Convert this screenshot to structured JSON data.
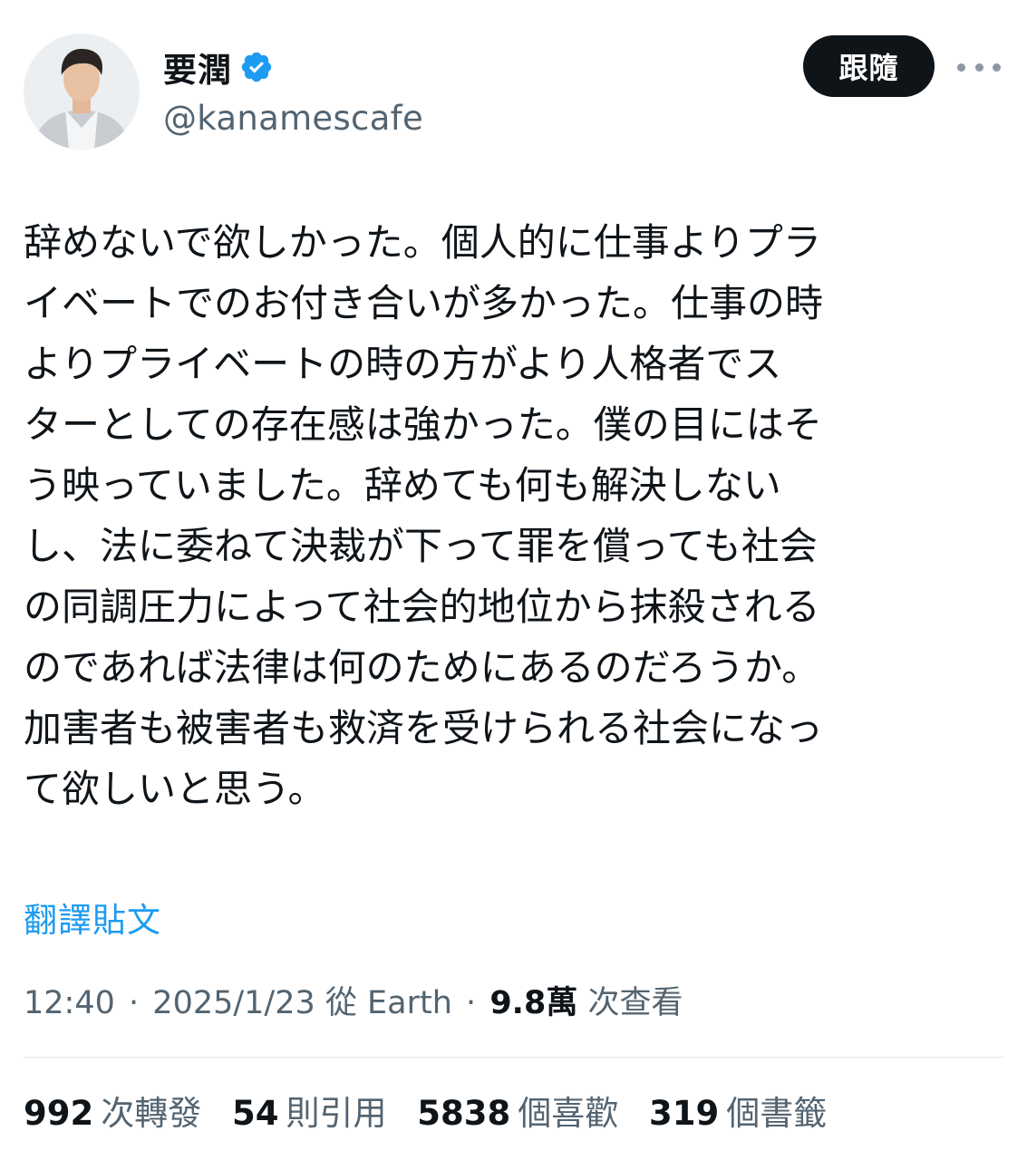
{
  "author": {
    "display_name": "要潤",
    "handle": "@kanamescafe",
    "verified": true
  },
  "header": {
    "follow_label": "跟隨"
  },
  "tweet": {
    "text": "辞めないで欲しかった。個人的に仕事よりプラ\nイベートでのお付き合いが多かった。仕事の時\nよりプライベートの時の方がより人格者でス\nターとしての存在感は強かった。僕の目にはそ\nう映っていました。辞めても何も解決しない\nし、法に委ねて決裁が下って罪を償っても社会\nの同調圧力によって社会的地位から抹殺される\nのであれば法律は何のためにあるのだろうか。\n加害者も被害者も救済を受けられる社会になっ\nて欲しいと思う。",
    "translate_label": "翻譯貼文"
  },
  "meta": {
    "time": "12:40",
    "date": "2025/1/23",
    "source": "從 Earth",
    "views_count": "9.8萬",
    "views_label": "次查看"
  },
  "stats": {
    "retweets_count": "992",
    "retweets_label": "次轉發",
    "quotes_count": "54",
    "quotes_label": "則引用",
    "likes_count": "5838",
    "likes_label": "個喜歡",
    "bookmarks_count": "319",
    "bookmarks_label": "個書籤"
  },
  "colors": {
    "verified_badge": "#1d9bf0",
    "link": "#1d9bf0",
    "secondary_text": "#536471",
    "primary_text": "#0f1419",
    "follow_button_bg": "#0f1419"
  },
  "icons": {
    "verified": "verified-badge-icon",
    "more": "more-horizontal-icon"
  }
}
